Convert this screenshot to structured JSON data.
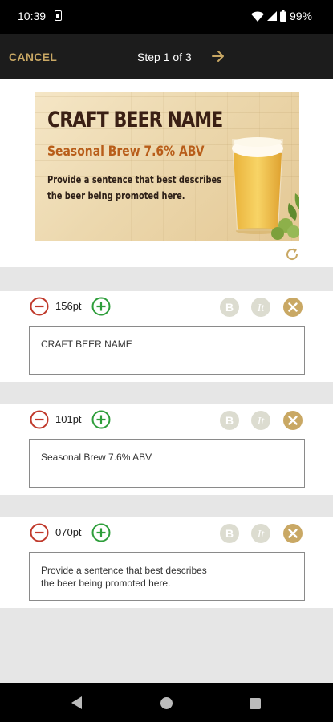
{
  "status_bar": {
    "time": "10:39",
    "battery_percent": "99%",
    "icons": [
      "sim-card-icon",
      "wifi-icon",
      "signal-icon",
      "battery-icon"
    ]
  },
  "app_bar": {
    "cancel_label": "CANCEL",
    "step_label": "Step 1 of 3",
    "next_icon": "arrow-right-icon"
  },
  "colors": {
    "accent": "#c9a864",
    "app_bar": "#1c1c1c",
    "minus": "#c0392b",
    "plus": "#2e9e3b",
    "disabled_format": "#dcdcd0"
  },
  "preview": {
    "title": "CRAFT BEER NAME",
    "subtitle": "Seasonal Brew 7.6% ABV",
    "description_line1": "Provide a sentence that best describes",
    "description_line2": "the beer being promoted here.",
    "refresh_icon": "refresh-icon"
  },
  "editors": [
    {
      "size": "156pt",
      "text": "CRAFT BEER NAME"
    },
    {
      "size": "101pt",
      "text": "Seasonal Brew 7.6% ABV"
    },
    {
      "size": "070pt",
      "text": "Provide a sentence that best describes\nthe beer being promoted here."
    }
  ],
  "format_buttons": {
    "bold": "B",
    "italic": "It"
  }
}
